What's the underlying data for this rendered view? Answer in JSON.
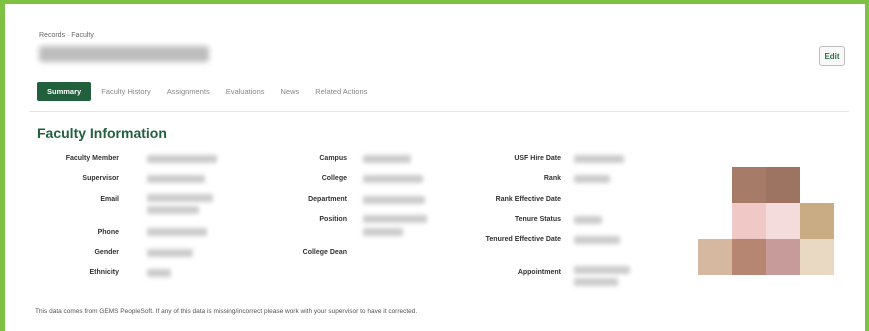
{
  "breadcrumb": "Records · Faculty",
  "person_name": "",
  "edit_button": "Edit",
  "tabs": [
    "Summary",
    "Faculty History",
    "Assignments",
    "Evaluations",
    "News",
    "Related Actions"
  ],
  "active_tab": "Summary",
  "section_title": "Faculty Information",
  "fields_col1": [
    "Faculty Member",
    "Supervisor",
    "Email",
    "Phone",
    "Gender",
    "Ethnicity"
  ],
  "fields_col2": [
    "Campus",
    "College",
    "Department",
    "Position",
    "College Dean"
  ],
  "fields_col3": [
    "USF Hire Date",
    "Rank",
    "Rank Effective Date",
    "Tenure Status",
    "Tenured Effective Date",
    "Appointment"
  ],
  "footer_note": "This data comes from GEMS PeopleSoft. If any of this data is missing/incorrect please work with your supervisor to have it corrected.",
  "colors": {
    "accent_green": "#7dc242",
    "primary_dark_green": "#215f3d",
    "photo_pixels": [
      "#a67c68",
      "#9d7462",
      "#f0c9c7",
      "#f4dcdc",
      "#c9ac84",
      "#d6b79f",
      "#b68673",
      "#c69b9a",
      "#e9d8c2"
    ]
  }
}
